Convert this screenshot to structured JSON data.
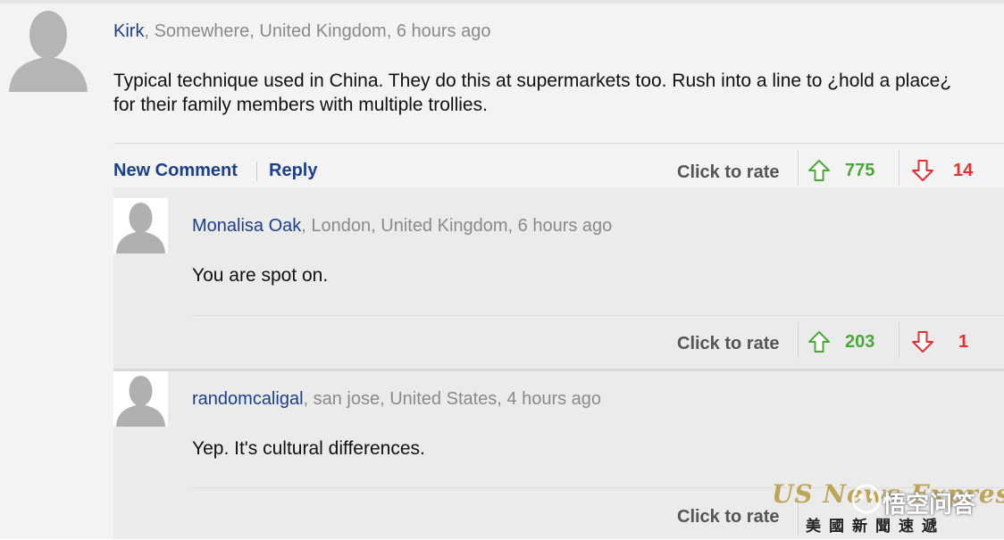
{
  "comments": [
    {
      "author": "Kirk",
      "location_time": ", Somewhere, United Kingdom, 6 hours ago",
      "text": "Typical technique used in China. They do this at supermarkets too. Rush into a line to ¿hold a place¿ for their family members with multiple trollies.",
      "actions": {
        "new_comment": "New Comment",
        "reply": "Reply"
      },
      "rate_label": "Click to rate",
      "up_count": "775",
      "down_count": "14"
    },
    {
      "author": "Monalisa Oak",
      "location_time": ", London, United Kingdom, 6 hours ago",
      "text": "You are spot on.",
      "rate_label": "Click to rate",
      "up_count": "203",
      "down_count": "1"
    },
    {
      "author": "randomcaligal",
      "location_time": ", san jose, United States, 4 hours ago",
      "text": "Yep. It's cultural differences.",
      "rate_label": "Click to rate"
    }
  ],
  "watermark": {
    "line1": "US News Express",
    "line2": "美國新聞速遞",
    "badge_text": "悟空问答"
  },
  "icons": {
    "upvote": "arrow-up-icon",
    "downvote": "arrow-down-icon",
    "avatar": "default-avatar-icon"
  },
  "colors": {
    "author_link": "#1b3f8c",
    "upvote": "#4aa83a",
    "downvote": "#e03030"
  }
}
